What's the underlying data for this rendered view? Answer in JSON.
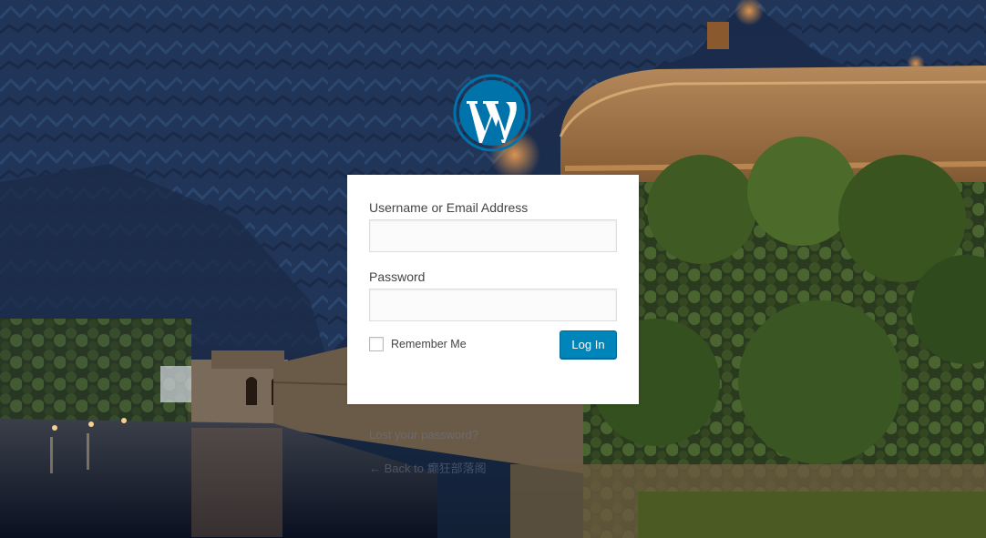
{
  "form": {
    "username_label": "Username or Email Address",
    "username_value": "",
    "password_label": "Password",
    "password_value": "",
    "remember_label": "Remember Me",
    "login_button": "Log In"
  },
  "links": {
    "lost_password": "Lost your password?",
    "back_to_site": "← Back to 癫狂部落阁"
  },
  "colors": {
    "button": "#0085ba",
    "logo": "#0073aa"
  },
  "icons": {
    "logo": "wordpress-logo-icon"
  }
}
